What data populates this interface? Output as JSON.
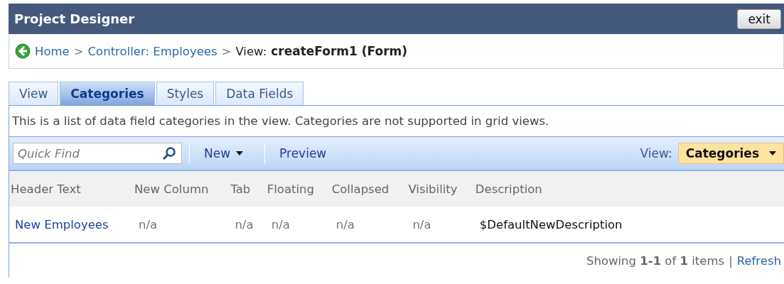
{
  "window": {
    "title": "Project Designer",
    "exit_button": "exit"
  },
  "breadcrumb": [
    {
      "kind": "link",
      "text": "Home"
    },
    {
      "kind": "sep",
      "text": ">"
    },
    {
      "kind": "link",
      "text": "Controller: Employees"
    },
    {
      "kind": "sep",
      "text": ">"
    },
    {
      "kind": "text",
      "text": "View:"
    },
    {
      "kind": "bold",
      "text": "createForm1 (Form)"
    }
  ],
  "tabs": [
    {
      "label": "View",
      "selected": false
    },
    {
      "label": "Categories",
      "selected": true
    },
    {
      "label": "Styles",
      "selected": false
    },
    {
      "label": "Data Fields",
      "selected": false
    }
  ],
  "description": "This is a list of data field categories in the view. Categories are not supported in grid views.",
  "toolbar": {
    "search": {
      "placeholder": "Quick Find"
    },
    "new_button": "New",
    "preview_button": "Preview",
    "view_label": "View:",
    "view_select": "Categories"
  },
  "table": {
    "columns": [
      "Header Text",
      "New Column",
      "Tab",
      "Floating",
      "Collapsed",
      "Visibility",
      "Description"
    ],
    "rows": [
      {
        "cells": [
          "New Employees",
          "n/a",
          "n/a",
          "n/a",
          "n/a",
          "n/a",
          "$DefaultNewDescription"
        ]
      }
    ]
  },
  "footer": {
    "summary": "Showing **1-1** of **1** items",
    "separator": "|",
    "refresh": "Refresh"
  }
}
